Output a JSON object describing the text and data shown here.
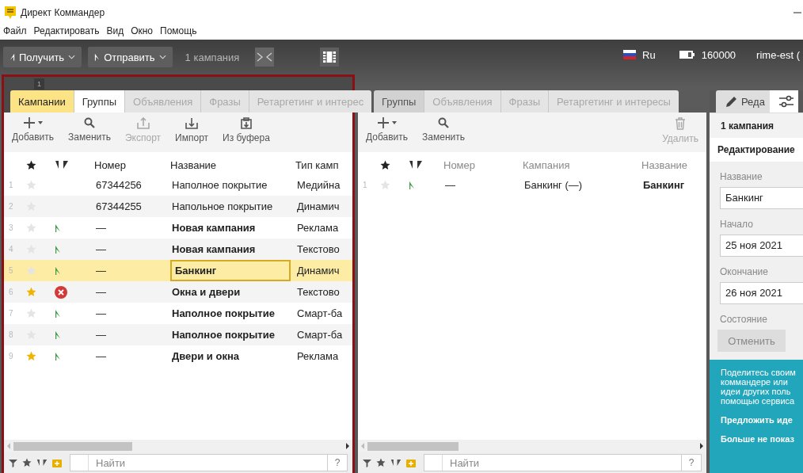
{
  "window": {
    "title": "Директ Коммандер"
  },
  "menu": [
    "Файл",
    "Редактировать",
    "Вид",
    "Окно",
    "Помощь"
  ],
  "toolbar": {
    "get_button": "Получить",
    "send_button": "Отправить",
    "selection_count": "1 кампания",
    "language": "Ru",
    "points": "160000",
    "user": "rime-est ("
  },
  "panels": [
    {
      "focused": true,
      "badge": "1",
      "tabs": [
        {
          "label": "Кампании",
          "selected": true,
          "disabled": false
        },
        {
          "label": "Группы",
          "selected": false,
          "disabled": false
        },
        {
          "label": "Объявления",
          "selected": false,
          "disabled": true
        },
        {
          "label": "Фразы",
          "selected": false,
          "disabled": true
        },
        {
          "label": "Ретаргетинг и интерес",
          "selected": false,
          "disabled": true
        }
      ],
      "actions": [
        {
          "kind": "add",
          "label": "Добавить",
          "disabled": false
        },
        {
          "kind": "replace",
          "label": "Заменить",
          "disabled": false
        },
        {
          "kind": "export",
          "label": "Экспорт",
          "disabled": true
        },
        {
          "kind": "import",
          "label": "Импорт",
          "disabled": false
        },
        {
          "kind": "paste",
          "label": "Из буфера",
          "disabled": false
        }
      ],
      "columns": [
        {
          "label": "Номер",
          "kind": "number"
        },
        {
          "label": "Название",
          "kind": "name"
        },
        {
          "label": "Тип камп",
          "kind": "type"
        }
      ],
      "rows": [
        {
          "index": "1",
          "starred": false,
          "error": false,
          "modified": false,
          "selected": false,
          "cells": [
            "67344256",
            "Наполное покрытие",
            "Медийна"
          ]
        },
        {
          "index": "2",
          "starred": false,
          "error": false,
          "modified": false,
          "selected": false,
          "cells": [
            "67344255",
            "Напольное покрытие",
            "Динамич"
          ]
        },
        {
          "index": "3",
          "starred": false,
          "error": false,
          "modified": true,
          "selected": false,
          "cells": [
            "—",
            "Новая кампания",
            "Реклама"
          ]
        },
        {
          "index": "4",
          "starred": false,
          "error": false,
          "modified": true,
          "selected": false,
          "cells": [
            "—",
            "Новая кампания",
            "Текстово"
          ]
        },
        {
          "index": "5",
          "starred": false,
          "error": false,
          "modified": true,
          "selected": true,
          "cells": [
            "—",
            "Банкинг",
            "Динамич"
          ]
        },
        {
          "index": "6",
          "starred": true,
          "error": true,
          "modified": true,
          "selected": false,
          "cells": [
            "—",
            "Окна и двери",
            "Текстово"
          ]
        },
        {
          "index": "7",
          "starred": false,
          "error": false,
          "modified": true,
          "selected": false,
          "cells": [
            "—",
            "Наполное покрытие",
            "Смарт-ба"
          ]
        },
        {
          "index": "8",
          "starred": false,
          "error": false,
          "modified": true,
          "selected": false,
          "cells": [
            "—",
            "Наполное покрытие",
            "Смарт-ба"
          ]
        },
        {
          "index": "9",
          "starred": true,
          "error": false,
          "modified": true,
          "selected": false,
          "cells": [
            "—",
            "Двери и окна",
            "Реклама"
          ]
        }
      ],
      "search": {
        "placeholder": "Найти",
        "help": "?"
      }
    },
    {
      "focused": false,
      "tabs": [
        {
          "label": "Группы",
          "selected": true,
          "disabled": false
        },
        {
          "label": "Объявления",
          "selected": false,
          "disabled": true
        },
        {
          "label": "Фразы",
          "selected": false,
          "disabled": true
        },
        {
          "label": "Ретаргетинг и интересы",
          "selected": false,
          "disabled": true
        }
      ],
      "actions": [
        {
          "kind": "add",
          "label": "Добавить",
          "disabled": false
        },
        {
          "kind": "replace",
          "label": "Заменить",
          "disabled": false
        },
        {
          "kind": "delete",
          "label": "Удалить",
          "disabled": true
        }
      ],
      "columns": [
        {
          "label": "Номер",
          "kind": "number"
        },
        {
          "label": "Кампания",
          "kind": "campaign"
        },
        {
          "label": "Название",
          "kind": "name"
        }
      ],
      "rows": [
        {
          "index": "1",
          "starred": false,
          "error": false,
          "modified": true,
          "selected": false,
          "cells": [
            "—",
            "Банкинг (—)",
            "Банкинг"
          ]
        }
      ],
      "search": {
        "placeholder": "Найти",
        "help": "?"
      }
    }
  ],
  "editor": {
    "tabs": [
      {
        "kind": "edit",
        "label": "Реда",
        "selected": true
      },
      {
        "kind": "settings",
        "selected": false
      }
    ],
    "heading": "1 кампания",
    "section": "Редактирование",
    "fields": [
      {
        "label": "Название",
        "value": "Банкинг"
      },
      {
        "label": "Начало",
        "value": "25 ноя 2021"
      },
      {
        "label": "Окончание",
        "value": "26 ноя 2021"
      }
    ],
    "state_label": "Состояние",
    "cancel_button": "Отменить",
    "promo": {
      "lines": [
        "Поделитесь своим",
        "коммандере или",
        "идеи других поль",
        "помощью сервиса"
      ],
      "links": [
        "Предложить иде",
        "Больше не показ"
      ]
    }
  }
}
